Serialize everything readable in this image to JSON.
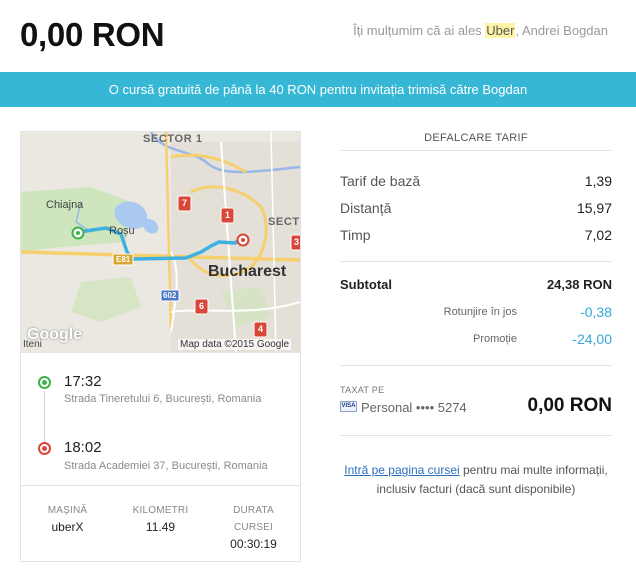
{
  "header": {
    "total": "0,00 RON",
    "thanks_before": "Îți mulțumim că ai ales ",
    "thanks_brand": "Uber",
    "thanks_after": ", Andrei Bogdan"
  },
  "banner": {
    "text": "O cursă gratuită de până la 40 RON pentru invitația trimisă către Bogdan"
  },
  "map": {
    "labels": {
      "sector1": "SECTOR 1",
      "sector_partial": "SECTO",
      "chiajna": "Chiajna",
      "rosu": "Roșu",
      "bucharest": "Bucharest",
      "e81": "E81",
      "a602": "602",
      "google": "Google",
      "iteni": "Iteni",
      "map_data": "Map data ©2015 Google"
    },
    "route_signs": [
      "7",
      "1",
      "3",
      "6",
      "4"
    ]
  },
  "trip": {
    "pickup_time": "17:32",
    "pickup_address": "Strada Tineretului 6, București, Romania",
    "dropoff_time": "18:02",
    "dropoff_address": "Strada Academiei 37, București, Romania"
  },
  "stats": {
    "car_label": "MAȘINĂ",
    "car_value": "uberX",
    "km_label": "KILOMETRI",
    "km_value": "11.49",
    "duration_label_1": "DURATA",
    "duration_label_2": "CURSEI",
    "duration_value": "00:30:19"
  },
  "fare": {
    "title": "DEFALCARE TARIF",
    "rows": [
      {
        "label": "Tarif de bază",
        "value": "1,39"
      },
      {
        "label": "Distanță",
        "value": "15,97"
      },
      {
        "label": "Timp",
        "value": "7,02"
      }
    ],
    "subtotal_label": "Subtotal",
    "subtotal_value": "24,38 RON",
    "rounding_label": "Rotunjire în jos",
    "rounding_value": "-0,38",
    "promo_label": "Promoție",
    "promo_value": "-24,00",
    "taxed_label": "TAXAT PE",
    "card_brand": "VISA",
    "payment_text": "Personal •••• 5274",
    "payment_total": "0,00 RON",
    "footer_link": "Intră pe pagina cursei",
    "footer_text_1": " pentru mai multe informații,",
    "footer_text_2": "inclusiv facturi (dacă sunt disponibile)"
  },
  "colors": {
    "banner": "#35b7d5",
    "route": "#3eb1e0",
    "pickup": "#3cb34a",
    "dropoff": "#d9473a",
    "adjustment": "#35a8d5",
    "link": "#2a6ebb"
  }
}
